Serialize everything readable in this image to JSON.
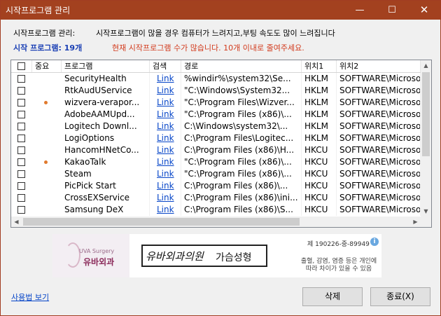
{
  "window": {
    "title": "시작프로그램 관리",
    "min": "—",
    "max": "☐",
    "close": "✕"
  },
  "info": {
    "label": "시작프로그램 관리:",
    "message": "시작프로그램이 많을 경우 컴퓨터가 느려지고,부팅 속도도 많이 느려집니다",
    "count": "시작 프로그램: 19개",
    "warning": "현재 시작프로그램 수가 많습니다. 10개 이내로 줄여주세요."
  },
  "table": {
    "headers": [
      "중요",
      "프로그램",
      "검색",
      "경로",
      "위치1",
      "위치2"
    ],
    "rows": [
      {
        "important": false,
        "program": "SecurityHealth",
        "search": "Link",
        "path": "%windir%\\system32\\Se...",
        "loc1": "HKLM",
        "loc2": "SOFTWARE\\Microso"
      },
      {
        "important": false,
        "program": "RtkAudUService",
        "search": "Link",
        "path": "\"C:\\Windows\\System32...",
        "loc1": "HKLM",
        "loc2": "SOFTWARE\\Microso"
      },
      {
        "important": true,
        "program": "wizvera-verapor...",
        "search": "Link",
        "path": "\"C:\\Program Files\\Wizver...",
        "loc1": "HKLM",
        "loc2": "SOFTWARE\\Microso"
      },
      {
        "important": false,
        "program": "AdobeAAMUpd...",
        "search": "Link",
        "path": "\"C:\\Program Files (x86)\\...",
        "loc1": "HKLM",
        "loc2": "SOFTWARE\\Microso"
      },
      {
        "important": false,
        "program": "Logitech Downl...",
        "search": "Link",
        "path": "C:\\Windows\\system32\\...",
        "loc1": "HKLM",
        "loc2": "SOFTWARE\\Microso"
      },
      {
        "important": false,
        "program": "LogiOptions",
        "search": "Link",
        "path": "C:\\Program Files\\Logitec...",
        "loc1": "HKLM",
        "loc2": "SOFTWARE\\Microso"
      },
      {
        "important": false,
        "program": "HancomHNetCo...",
        "search": "Link",
        "path": "C:\\Program Files (x86)\\H...",
        "loc1": "HKCU",
        "loc2": "SOFTWARE\\Microso"
      },
      {
        "important": true,
        "program": "KakaoTalk",
        "search": "Link",
        "path": "\"C:\\Program Files (x86)\\...",
        "loc1": "HKCU",
        "loc2": "SOFTWARE\\Microso"
      },
      {
        "important": false,
        "program": "Steam",
        "search": "Link",
        "path": "\"C:\\Program Files (x86)\\...",
        "loc1": "HKCU",
        "loc2": "SOFTWARE\\Microso"
      },
      {
        "important": false,
        "program": "PicPick Start",
        "search": "Link",
        "path": "C:\\Program Files (x86)\\...",
        "loc1": "HKCU",
        "loc2": "SOFTWARE\\Microso"
      },
      {
        "important": false,
        "program": "CrossEXService",
        "search": "Link",
        "path": "C:\\Program Files (x86)\\ini...",
        "loc1": "HKCU",
        "loc2": "SOFTWARE\\Microso"
      },
      {
        "important": false,
        "program": "Samsung DeX",
        "search": "Link",
        "path": "C:\\Program Files (x86)\\S...",
        "loc1": "HKCU",
        "loc2": "SOFTWARE\\Microso"
      }
    ]
  },
  "banner": {
    "brand_en": "UVA Surgery",
    "brand": "유바외과",
    "slogan_hand": "유바외과의원",
    "slogan": "가슴성형",
    "reg": "제 190226-중-89949",
    "info_icon": "i",
    "note": "출혈, 감염, 염증 등은 개인에 따라 차이가 있을 수 있음"
  },
  "footer": {
    "usage": "사용법 보기",
    "delete": "삭제",
    "exit": "종료(X)"
  },
  "colors": {
    "titlebar": "#a3411f",
    "warning": "#d23a1c",
    "count": "#1a3fb4",
    "link": "#0645c8",
    "dot": "#e07a2e"
  }
}
